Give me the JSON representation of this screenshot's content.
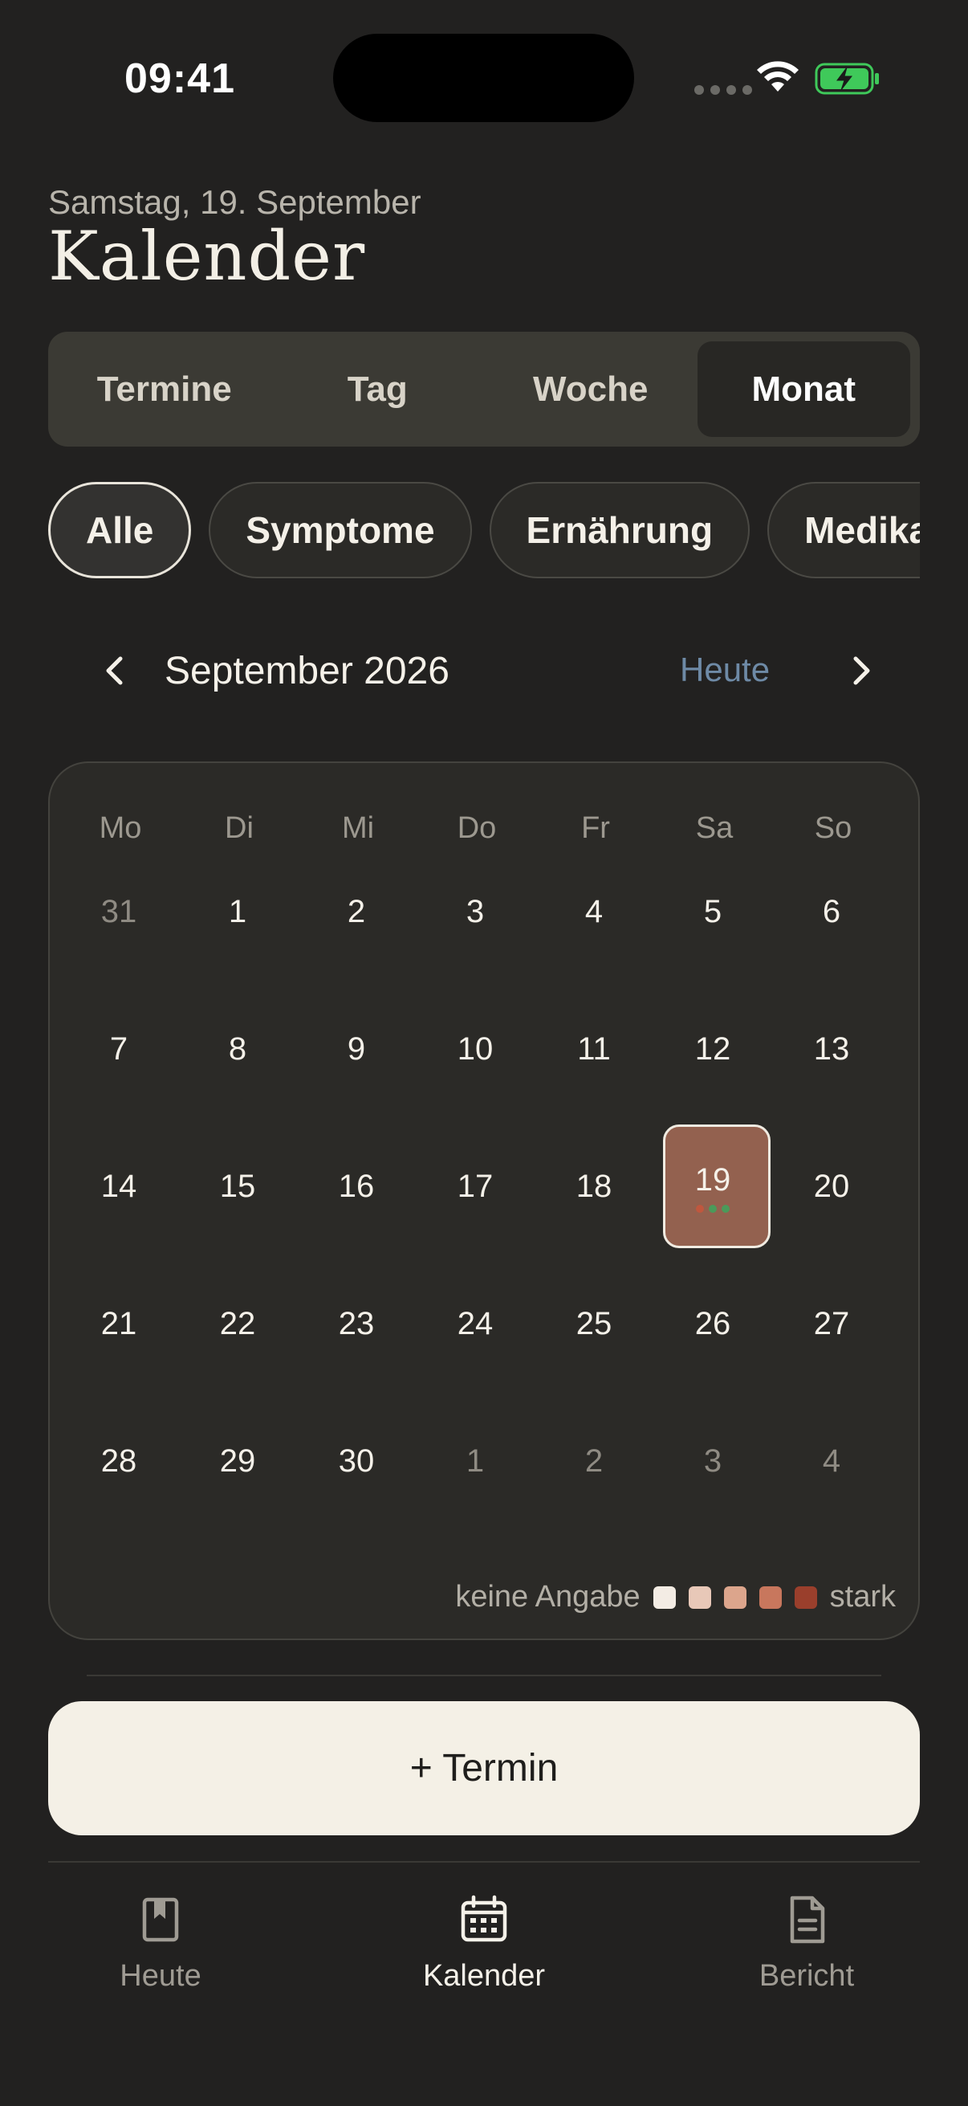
{
  "status_bar": {
    "time": "09:41"
  },
  "header": {
    "date_line": "Samstag, 19. September",
    "title": "Kalender"
  },
  "view_tabs": [
    {
      "label": "Termine",
      "active": false
    },
    {
      "label": "Tag",
      "active": false
    },
    {
      "label": "Woche",
      "active": false
    },
    {
      "label": "Monat",
      "active": true
    }
  ],
  "filters": [
    {
      "label": "Alle",
      "active": true
    },
    {
      "label": "Symptome",
      "active": false
    },
    {
      "label": "Ernährung",
      "active": false
    },
    {
      "label": "Medika",
      "active": false
    }
  ],
  "month_nav": {
    "label": "September 2026",
    "today_label": "Heute"
  },
  "calendar": {
    "weekdays": [
      "Mo",
      "Di",
      "Mi",
      "Do",
      "Fr",
      "Sa",
      "So"
    ],
    "days": [
      {
        "n": "31",
        "muted": true
      },
      {
        "n": "1"
      },
      {
        "n": "2"
      },
      {
        "n": "3"
      },
      {
        "n": "4"
      },
      {
        "n": "5"
      },
      {
        "n": "6"
      },
      {
        "n": "7"
      },
      {
        "n": "8"
      },
      {
        "n": "9"
      },
      {
        "n": "10"
      },
      {
        "n": "11"
      },
      {
        "n": "12"
      },
      {
        "n": "13"
      },
      {
        "n": "14"
      },
      {
        "n": "15"
      },
      {
        "n": "16"
      },
      {
        "n": "17"
      },
      {
        "n": "18"
      },
      {
        "n": "19",
        "selected": true,
        "dots": [
          "#c0573e",
          "#4b9a5a",
          "#4b9a5a"
        ]
      },
      {
        "n": "20"
      },
      {
        "n": "21"
      },
      {
        "n": "22"
      },
      {
        "n": "23"
      },
      {
        "n": "24"
      },
      {
        "n": "25"
      },
      {
        "n": "26"
      },
      {
        "n": "27"
      },
      {
        "n": "28"
      },
      {
        "n": "29"
      },
      {
        "n": "30"
      },
      {
        "n": "1",
        "muted": true
      },
      {
        "n": "2",
        "muted": true
      },
      {
        "n": "3",
        "muted": true
      },
      {
        "n": "4",
        "muted": true
      }
    ],
    "legend": {
      "low_label": "keine Angabe",
      "high_label": "stark",
      "colors": [
        "#f3ece4",
        "#e8c8b8",
        "#dca58c",
        "#c8775d",
        "#9a3f2c"
      ]
    }
  },
  "add_button": {
    "label": "+ Termin"
  },
  "tabbar": [
    {
      "label": "Heute",
      "icon": "bookmark-book-icon",
      "active": false
    },
    {
      "label": "Kalender",
      "icon": "calendar-icon",
      "active": true
    },
    {
      "label": "Bericht",
      "icon": "document-icon",
      "active": false
    }
  ],
  "colors": {
    "background": "#222120",
    "selected_day": "#93614f",
    "accent_link": "#6e8aa6",
    "battery": "#3fc95a"
  }
}
